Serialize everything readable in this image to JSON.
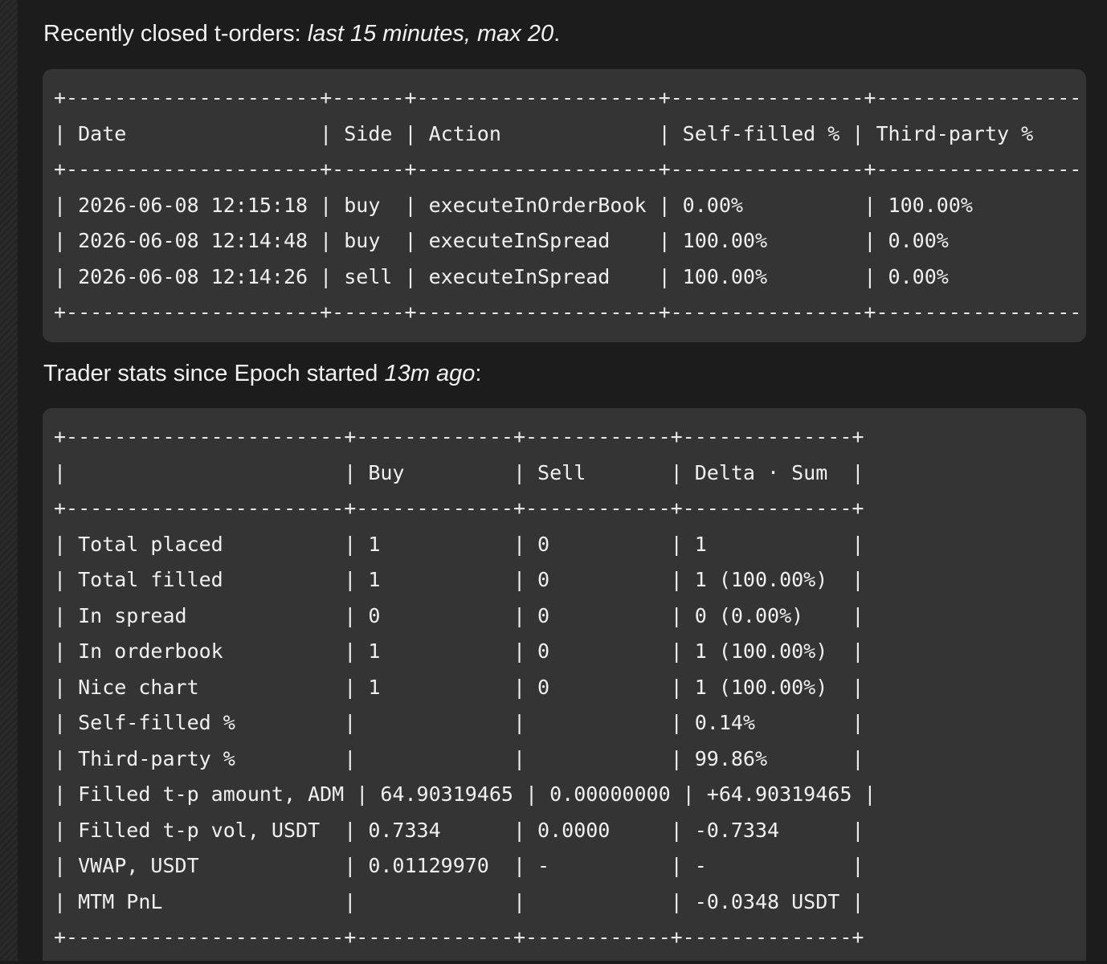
{
  "section1": {
    "heading_text": "Recently closed t-orders: ",
    "heading_italic": "last 15 minutes, max 20",
    "heading_suffix": ".",
    "table": {
      "border_line": "+---------------------+------+--------------------+----------------+-----------------",
      "header_row": "| Date                | Side | Action             | Self-filled % | Third-party %",
      "rows": [
        "| 2026-06-08 12:15:18 | buy  | executeInOrderBook | 0.00%          | 100.00%",
        "| 2026-06-08 12:14:48 | buy  | executeInSpread    | 100.00%        | 0.00%",
        "| 2026-06-08 12:14:26 | sell | executeInSpread    | 100.00%        | 0.00%"
      ]
    }
  },
  "section2": {
    "heading_part1": "Trader stats",
    "heading_part2": " since Epoch started ",
    "heading_italic": "13m ago",
    "heading_suffix": ":",
    "table": {
      "border_line": "+-----------------------+-------------+------------+--------------+",
      "header_row": "|                       | Buy         | Sell       | Delta · Sum  |",
      "rows": [
        "| Total placed          | 1           | 0          | 1            |",
        "| Total filled          | 1           | 0          | 1 (100.00%)  |",
        "| In spread             | 0           | 0          | 0 (0.00%)    |",
        "| In orderbook          | 1           | 0          | 1 (100.00%)  |",
        "| Nice chart            | 1           | 0          | 1 (100.00%)  |",
        "| Self-filled %         |             |            | 0.14%        |",
        "| Third-party %         |             |            | 99.86%       |",
        "| Filled t-p amount, ADM | 64.90319465 | 0.00000000 | +64.90319465 |",
        "| Filled t-p vol, USDT  | 0.7334      | 0.0000     | -0.7334      |",
        "| VWAP, USDT            | 0.01129970  | -          | -            |",
        "| MTM PnL               |             |            | -0.0348 USDT |"
      ]
    }
  }
}
